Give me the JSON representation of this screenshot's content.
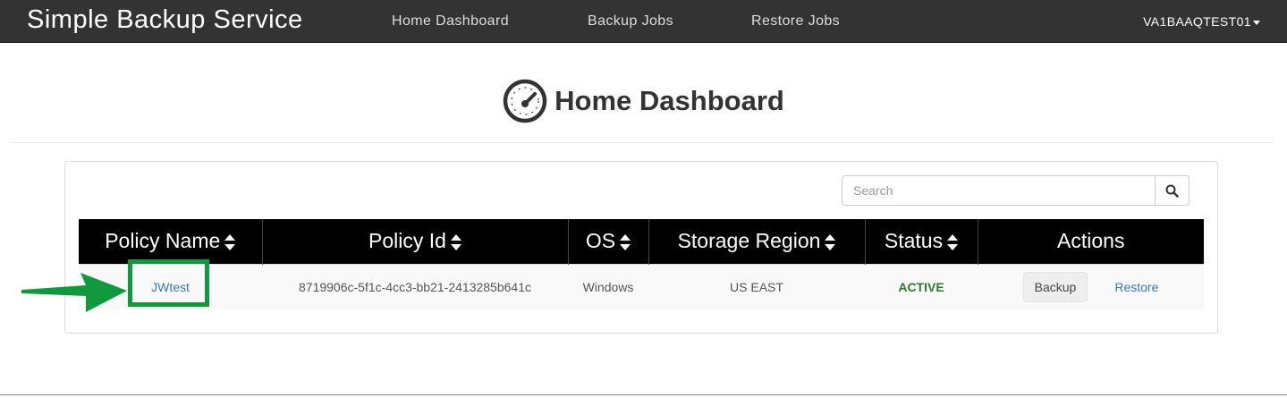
{
  "navbar": {
    "brand": "Simple Backup Service",
    "links": [
      "Home Dashboard",
      "Backup Jobs",
      "Restore Jobs"
    ],
    "user": "VA1BAAQTEST01"
  },
  "header": {
    "title": "Home Dashboard",
    "icon": "dashboard-gauge-icon"
  },
  "search": {
    "placeholder": "Search",
    "icon": "search-icon"
  },
  "table": {
    "columns": [
      "Policy Name",
      "Policy Id",
      "OS",
      "Storage Region",
      "Status",
      "Actions"
    ],
    "rows": [
      {
        "policy_name": "JWtest",
        "policy_id": "8719906c-5f1c-4cc3-bb21-2413285b641c",
        "os": "Windows",
        "region": "US EAST",
        "status": "ACTIVE",
        "action_backup": "Backup",
        "action_restore": "Restore"
      }
    ]
  },
  "annotation": {
    "color": "#119a3d"
  }
}
